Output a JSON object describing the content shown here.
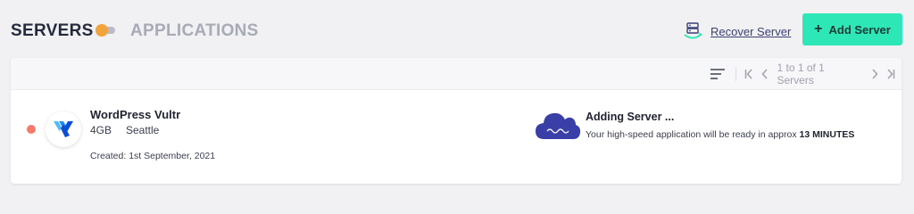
{
  "header": {
    "servers_tab": "SERVERS",
    "applications_tab": "APPLICATIONS",
    "recover_label": "Recover Server",
    "add_label": "Add Server"
  },
  "toolbar": {
    "pagination_text": "1 to 1 of 1 Servers"
  },
  "servers": [
    {
      "name": "WordPress Vultr",
      "size": "4GB",
      "location": "Seattle",
      "created": "Created: 1st September, 2021",
      "status_title": "Adding Server ...",
      "status_message": "Your high-speed application will be ready in approx",
      "eta": "13 MINUTES"
    }
  ],
  "colors": {
    "accent": "#2ee7b7",
    "toggle_knob": "#f2a33a",
    "status_dot": "#f47b6c",
    "cloud": "#3a3fa8",
    "vultr_blue": "#007bfc"
  },
  "icons": {
    "recover": "server-recover-icon",
    "add": "plus-icon",
    "sort": "sort-lines-icon",
    "first": "first-page-icon",
    "prev": "prev-page-icon",
    "next": "next-page-icon",
    "last": "last-page-icon",
    "logo": "vultr-logo",
    "cloud": "cloud-progress-icon"
  }
}
